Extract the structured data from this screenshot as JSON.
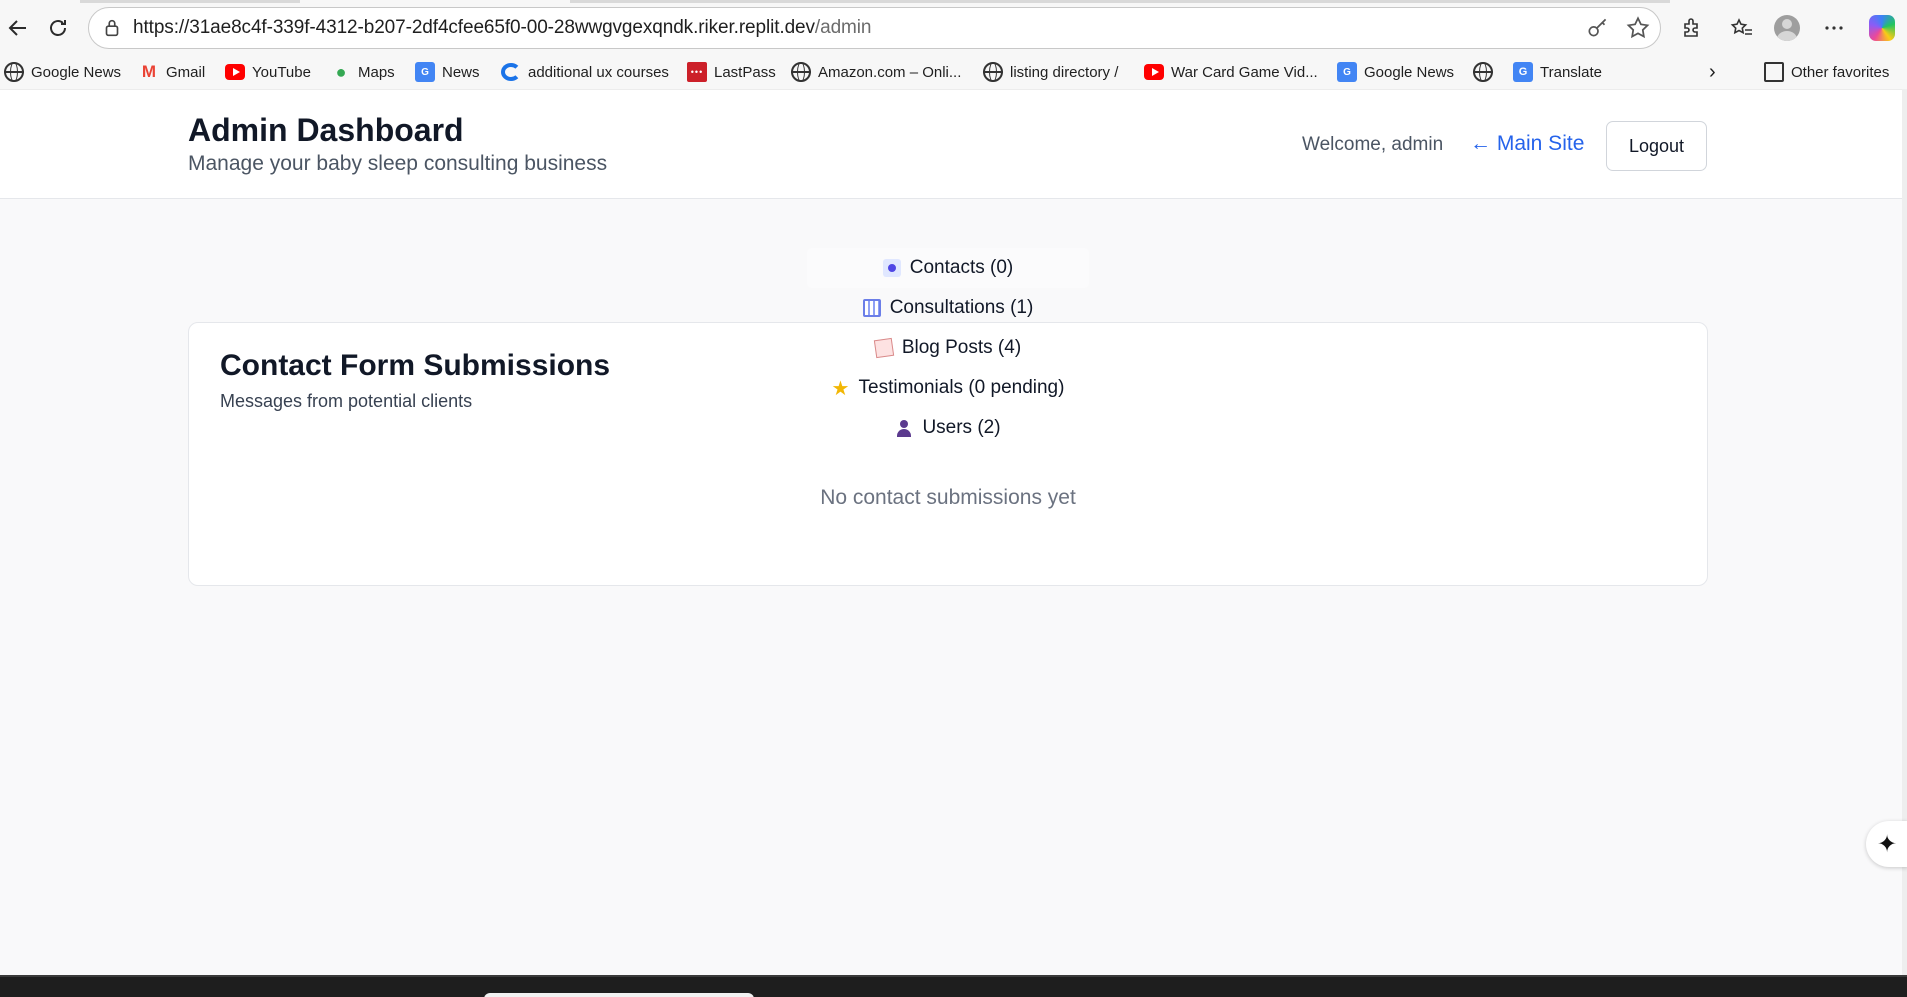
{
  "browser": {
    "url_host": "https://31ae8c4f-339f-4312-b207-2df4cfee65f0-00-28wwgvgexqndk.riker.replit.dev",
    "url_path": "/admin",
    "bookmarks": [
      {
        "label": "Google News",
        "icon": "globe-icon"
      },
      {
        "label": "Gmail",
        "icon": "gmail-icon"
      },
      {
        "label": "YouTube",
        "icon": "youtube-icon"
      },
      {
        "label": "Maps",
        "icon": "maps-icon"
      },
      {
        "label": "News",
        "icon": "google-news-icon"
      },
      {
        "label": "additional ux courses",
        "icon": "c-logo-icon"
      },
      {
        "label": "LastPass",
        "icon": "lastpass-icon"
      },
      {
        "label": "Amazon.com – Onli...",
        "icon": "globe-icon"
      },
      {
        "label": "listing directory /",
        "icon": "globe-icon"
      },
      {
        "label": "War Card Game Vid...",
        "icon": "youtube-icon"
      },
      {
        "label": "Google News",
        "icon": "google-news-icon"
      },
      {
        "label": "",
        "icon": "globe-icon"
      },
      {
        "label": "Translate",
        "icon": "translate-icon"
      }
    ],
    "other_favorites": "Other favorites"
  },
  "header": {
    "title": "Admin Dashboard",
    "subtitle": "Manage your baby sleep consulting business",
    "welcome": "Welcome, admin",
    "main_site": "← Main Site",
    "logout": "Logout"
  },
  "tabs": [
    {
      "label": "Contacts (0)",
      "icon": "contacts-icon",
      "active": true
    },
    {
      "label": "Consultations (1)",
      "icon": "calendar-icon",
      "active": false
    },
    {
      "label": "Blog Posts (4)",
      "icon": "memo-icon",
      "active": false
    },
    {
      "label": "Testimonials (0 pending)",
      "icon": "star-icon",
      "active": false
    },
    {
      "label": "Users (2)",
      "icon": "user-icon",
      "active": false
    }
  ],
  "card": {
    "title": "Contact Form Submissions",
    "subtitle": "Messages from potential clients",
    "empty_message": "No contact submissions yet"
  }
}
